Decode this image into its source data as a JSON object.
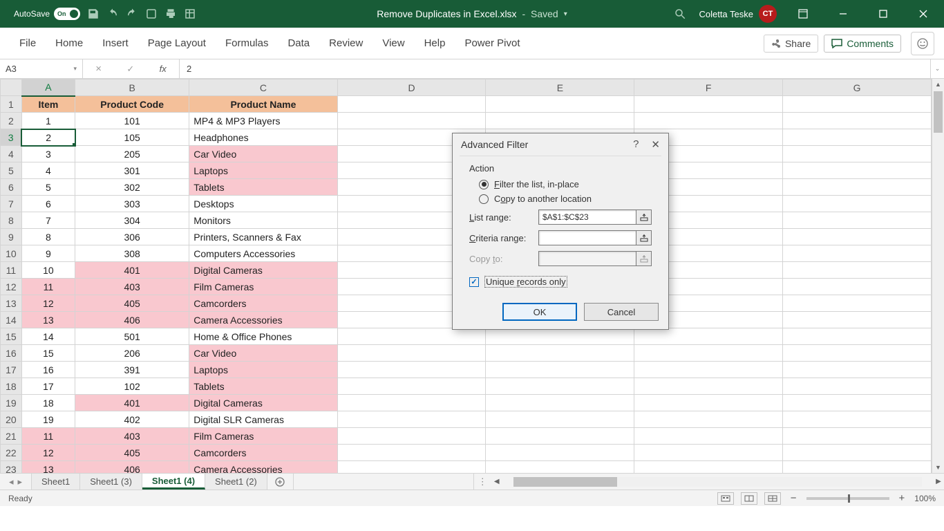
{
  "titlebar": {
    "autosave_label": "AutoSave",
    "autosave_on": "On",
    "doc_name": "Remove Duplicates in Excel.xlsx",
    "saved_status": "Saved",
    "user_name": "Coletta Teske",
    "user_initials": "CT"
  },
  "ribbon": {
    "tabs": [
      "File",
      "Home",
      "Insert",
      "Page Layout",
      "Formulas",
      "Data",
      "Review",
      "View",
      "Help",
      "Power Pivot"
    ],
    "share": "Share",
    "comments": "Comments"
  },
  "formula_bar": {
    "name_box": "A3",
    "fx_label": "fx",
    "value": "2"
  },
  "columns": [
    "A",
    "B",
    "C",
    "D",
    "E",
    "F",
    "G"
  ],
  "header_row": [
    "Item",
    "Product Code",
    "Product Name"
  ],
  "rows": [
    {
      "n": 1,
      "a": "Item",
      "b": "Product Code",
      "c": "Product Name",
      "hdr": true
    },
    {
      "n": 2,
      "a": "1",
      "b": "101",
      "c": "MP4 & MP3 Players"
    },
    {
      "n": 3,
      "a": "2",
      "b": "105",
      "c": "Headphones",
      "sel": true
    },
    {
      "n": 4,
      "a": "3",
      "b": "205",
      "c": "Car Video",
      "pc": true
    },
    {
      "n": 5,
      "a": "4",
      "b": "301",
      "c": "Laptops",
      "pc": true
    },
    {
      "n": 6,
      "a": "5",
      "b": "302",
      "c": "Tablets",
      "pc": true
    },
    {
      "n": 7,
      "a": "6",
      "b": "303",
      "c": "Desktops"
    },
    {
      "n": 8,
      "a": "7",
      "b": "304",
      "c": "Monitors"
    },
    {
      "n": 9,
      "a": "8",
      "b": "306",
      "c": "Printers, Scanners & Fax"
    },
    {
      "n": 10,
      "a": "9",
      "b": "308",
      "c": "Computers Accessories"
    },
    {
      "n": 11,
      "a": "10",
      "b": "401",
      "c": "Digital Cameras",
      "pb": true,
      "pc": true
    },
    {
      "n": 12,
      "a": "11",
      "b": "403",
      "c": "Film Cameras",
      "pa": true,
      "pb": true,
      "pc": true
    },
    {
      "n": 13,
      "a": "12",
      "b": "405",
      "c": "Camcorders",
      "pa": true,
      "pb": true,
      "pc": true
    },
    {
      "n": 14,
      "a": "13",
      "b": "406",
      "c": "Camera Accessories",
      "pa": true,
      "pb": true,
      "pc": true
    },
    {
      "n": 15,
      "a": "14",
      "b": "501",
      "c": "Home & Office Phones"
    },
    {
      "n": 16,
      "a": "15",
      "b": "206",
      "c": "Car Video",
      "pc": true
    },
    {
      "n": 17,
      "a": "16",
      "b": "391",
      "c": "Laptops",
      "pc": true
    },
    {
      "n": 18,
      "a": "17",
      "b": "102",
      "c": "Tablets",
      "pc": true
    },
    {
      "n": 19,
      "a": "18",
      "b": "401",
      "c": "Digital Cameras",
      "pb": true,
      "pc": true
    },
    {
      "n": 20,
      "a": "19",
      "b": "402",
      "c": "Digital SLR Cameras"
    },
    {
      "n": 21,
      "a": "11",
      "b": "403",
      "c": "Film Cameras",
      "pa": true,
      "pb": true,
      "pc": true
    },
    {
      "n": 22,
      "a": "12",
      "b": "405",
      "c": "Camcorders",
      "pa": true,
      "pb": true,
      "pc": true
    },
    {
      "n": 23,
      "a": "13",
      "b": "406",
      "c": "Camera Accessories",
      "pa": true,
      "pb": true,
      "pc": true
    }
  ],
  "dialog": {
    "title": "Advanced Filter",
    "action_label": "Action",
    "radio_inplace": "Filter the list, in-place",
    "radio_copy": "Copy to another location",
    "list_range_label": "List range:",
    "list_range_value": "$A$1:$C$23",
    "criteria_label": "Criteria range:",
    "criteria_value": "",
    "copyto_label": "Copy to:",
    "copyto_value": "",
    "unique_label": "Unique records only",
    "ok": "OK",
    "cancel": "Cancel"
  },
  "sheets": {
    "tabs": [
      {
        "name": "Sheet1",
        "active": false
      },
      {
        "name": "Sheet1 (3)",
        "active": false
      },
      {
        "name": "Sheet1 (4)",
        "active": true
      },
      {
        "name": "Sheet1 (2)",
        "active": false
      }
    ]
  },
  "status": {
    "ready": "Ready",
    "zoom": "100%"
  }
}
